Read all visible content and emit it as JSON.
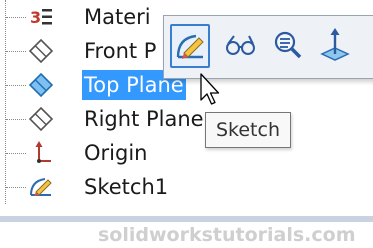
{
  "tree": {
    "items": [
      {
        "label": "Materi",
        "icon": "material-icon"
      },
      {
        "label": "Front P",
        "icon": "plane-icon"
      },
      {
        "label": "Top Plane",
        "icon": "plane-icon",
        "selected": true
      },
      {
        "label": "Right Plane",
        "icon": "plane-icon"
      },
      {
        "label": "Origin",
        "icon": "origin-icon"
      },
      {
        "label": "Sketch1",
        "icon": "sketch-icon"
      }
    ]
  },
  "context_toolbar": {
    "buttons": [
      {
        "icon": "sketch-icon",
        "active": true
      },
      {
        "icon": "show-hide-glasses-icon"
      },
      {
        "icon": "zoom-to-selection-icon"
      },
      {
        "icon": "normal-to-icon"
      }
    ]
  },
  "tooltip": {
    "text": "Sketch"
  },
  "watermark": {
    "text": "solidworkstutorials.com"
  },
  "colors": {
    "selection": "#3399ff",
    "toolbar_bg": "#eef1f6",
    "active_border": "#3a7fcf",
    "band": "#c9d3e0"
  }
}
